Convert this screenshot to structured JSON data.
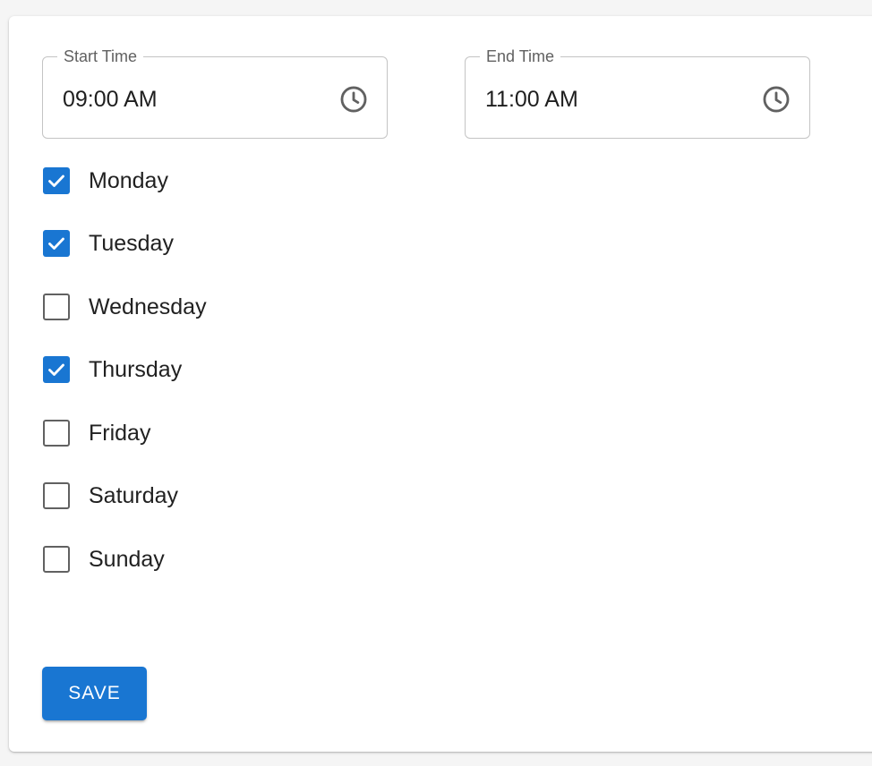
{
  "form": {
    "start_time": {
      "label": "Start Time",
      "value": "09:00 AM",
      "icon": "clock-icon"
    },
    "end_time": {
      "label": "End Time",
      "value": "11:00 AM",
      "icon": "clock-icon"
    },
    "days": [
      {
        "label": "Monday",
        "checked": true
      },
      {
        "label": "Tuesday",
        "checked": true
      },
      {
        "label": "Wednesday",
        "checked": false
      },
      {
        "label": "Thursday",
        "checked": true
      },
      {
        "label": "Friday",
        "checked": false
      },
      {
        "label": "Saturday",
        "checked": false
      },
      {
        "label": "Sunday",
        "checked": false
      }
    ],
    "save_label": "SAVE"
  },
  "colors": {
    "accent": "#1976d2",
    "checkbox_unchecked_border": "#616161",
    "outline": "#c4c4c4",
    "label_text": "#616161",
    "text": "#212121",
    "page_background": "#f5f5f5",
    "card_background": "#ffffff"
  }
}
